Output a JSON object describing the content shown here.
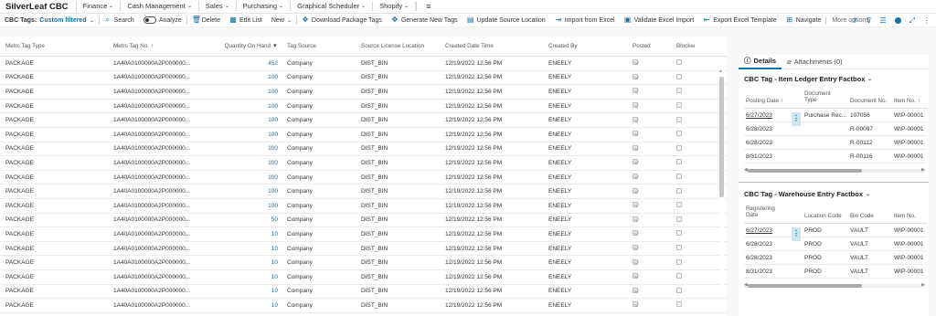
{
  "app": {
    "title": "SilverLeaf CBC"
  },
  "nav": [
    {
      "label": "Finance"
    },
    {
      "label": "Cash Management"
    },
    {
      "label": "Sales"
    },
    {
      "label": "Purchasing"
    },
    {
      "label": "Graphical Scheduler"
    },
    {
      "label": "Shopify"
    }
  ],
  "actionbar": {
    "tags_label": "CBC Tags:",
    "filter_label": "Custom filtered",
    "search": "Search",
    "analyze": "Analyze",
    "delete": "Delete",
    "edit_list": "Edit List",
    "new": "New",
    "download": "Download Package Tags",
    "generate": "Generate New Tags",
    "update": "Update Source Location",
    "import": "Import from Excel",
    "validate": "Validate Excel Import",
    "export": "Export Excel Template",
    "navigate": "Navigate",
    "more": "More options"
  },
  "list": {
    "columns": [
      "Metrc Tag Type",
      "Metrc Tag No. ↑",
      "Quantity On Hand",
      "Tag Source",
      "Source License Location",
      "Created Date Time",
      "Created By",
      "Posted",
      "Blocked"
    ],
    "rows": [
      {
        "type": "PACKAGE",
        "tag": "1A40A0100000A2P000000...",
        "qty": "452",
        "source": "Company",
        "loc": "DIST_BIN",
        "created": "12/19/2022 12:56 PM",
        "by": "ENEELY"
      },
      {
        "type": "PACKAGE",
        "tag": "1A40A0100000A2P000000...",
        "qty": "100",
        "source": "Company",
        "loc": "DIST_BIN",
        "created": "12/19/2022 12:56 PM",
        "by": "ENEELY"
      },
      {
        "type": "PACKAGE",
        "tag": "1A40A0100000A2P000000...",
        "qty": "100",
        "source": "Company",
        "loc": "DIST_BIN",
        "created": "12/19/2022 12:56 PM",
        "by": "ENEELY"
      },
      {
        "type": "PACKAGE",
        "tag": "1A40A0100000A2P000000...",
        "qty": "100",
        "source": "Company",
        "loc": "DIST_BIN",
        "created": "12/19/2022 12:56 PM",
        "by": "ENEELY"
      },
      {
        "type": "PACKAGE",
        "tag": "1A40A0100000A2P000000...",
        "qty": "100",
        "source": "Company",
        "loc": "DIST_BIN",
        "created": "12/19/2022 12:56 PM",
        "by": "ENEELY"
      },
      {
        "type": "PACKAGE",
        "tag": "1A40A0100000A2P000000...",
        "qty": "100",
        "source": "Company",
        "loc": "DIST_BIN",
        "created": "12/19/2022 12:56 PM",
        "by": "ENEELY"
      },
      {
        "type": "PACKAGE",
        "tag": "1A40A0100000A2P000000...",
        "qty": "100",
        "source": "Company",
        "loc": "DIST_BIN",
        "created": "12/19/2022 12:56 PM",
        "by": "ENEELY"
      },
      {
        "type": "PACKAGE",
        "tag": "1A40A0100000A2P000000...",
        "qty": "100",
        "source": "Company",
        "loc": "DIST_BIN",
        "created": "12/19/2022 12:56 PM",
        "by": "ENEELY"
      },
      {
        "type": "PACKAGE",
        "tag": "1A40A0100000A2P000000...",
        "qty": "100",
        "source": "Company",
        "loc": "DIST_BIN",
        "created": "12/19/2022 12:56 PM",
        "by": "ENEELY"
      },
      {
        "type": "PACKAGE",
        "tag": "1A40A0100000A2P000000...",
        "qty": "100",
        "source": "Company",
        "loc": "DIST_BIN",
        "created": "12/19/2022 12:56 PM",
        "by": "ENEELY"
      },
      {
        "type": "PACKAGE",
        "tag": "1A40A0100000A2P000000...",
        "qty": "100",
        "source": "Company",
        "loc": "DIST_BIN",
        "created": "12/19/2022 12:56 PM",
        "by": "ENEELY"
      },
      {
        "type": "PACKAGE",
        "tag": "1A40A0100000A2P000000...",
        "qty": "50",
        "source": "Company",
        "loc": "DIST_BIN",
        "created": "12/19/2022 12:56 PM",
        "by": "ENEELY"
      },
      {
        "type": "PACKAGE",
        "tag": "1A40A0100000A2P000000...",
        "qty": "10",
        "source": "Company",
        "loc": "DIST_BIN",
        "created": "12/19/2022 12:56 PM",
        "by": "ENEELY"
      },
      {
        "type": "PACKAGE",
        "tag": "1A40A0100000A2P000000...",
        "qty": "10",
        "source": "Company",
        "loc": "DIST_BIN",
        "created": "12/19/2022 12:56 PM",
        "by": "ENEELY"
      },
      {
        "type": "PACKAGE",
        "tag": "1A40A0100000A2P000000...",
        "qty": "10",
        "source": "Company",
        "loc": "DIST_BIN",
        "created": "12/19/2022 12:56 PM",
        "by": "ENEELY"
      },
      {
        "type": "PACKAGE",
        "tag": "1A40A0100000A2P000000...",
        "qty": "10",
        "source": "Company",
        "loc": "DIST_BIN",
        "created": "12/19/2022 12:56 PM",
        "by": "ENEELY"
      },
      {
        "type": "PACKAGE",
        "tag": "1A40A0100000A2P000000...",
        "qty": "10",
        "source": "Company",
        "loc": "DIST_BIN",
        "created": "12/19/2022 12:56 PM",
        "by": "ENEELY"
      },
      {
        "type": "PACKAGE",
        "tag": "1A40A0100000A2P000000...",
        "qty": "10",
        "source": "Company",
        "loc": "DIST_BIN",
        "created": "12/19/2022 12:56 PM",
        "by": "ENEELY"
      }
    ]
  },
  "factbox": {
    "tabs": {
      "details": "Details",
      "attachments": "Attachments (0)"
    },
    "ile": {
      "title": "CBC Tag - Item Ledger Entry Factbox",
      "columns": [
        "Posting Date ↑",
        "Document Type",
        "Document No.",
        "Item No. ↑"
      ],
      "rows": [
        {
          "date": "6/27/2023",
          "doctype": "Purchase Rec...",
          "docno": "107056",
          "item": "WIP-00001"
        },
        {
          "date": "6/28/2023",
          "doctype": "",
          "docno": "R-00097",
          "item": "WIP-00001"
        },
        {
          "date": "6/28/2023",
          "doctype": "",
          "docno": "R-00112",
          "item": "WIP-00001"
        },
        {
          "date": "8/31/2023",
          "doctype": "",
          "docno": "R-00116",
          "item": "WIP-00001"
        }
      ]
    },
    "wh": {
      "title": "CBC Tag - Warehouse Entry Factbox",
      "columns": [
        "Registering Date",
        "Location Code",
        "Bin Code",
        "Item No."
      ],
      "rows": [
        {
          "date": "6/27/2023",
          "loc": "PROD",
          "bin": "VAULT",
          "item": "WIP-00001"
        },
        {
          "date": "6/28/2023",
          "loc": "PROD",
          "bin": "VAULT",
          "item": "WIP-00001"
        },
        {
          "date": "6/28/2023",
          "loc": "PROD",
          "bin": "VAULT",
          "item": "WIP-00001"
        },
        {
          "date": "8/31/2023",
          "loc": "PROD",
          "bin": "VAULT",
          "item": "WIP-00001"
        }
      ]
    }
  }
}
